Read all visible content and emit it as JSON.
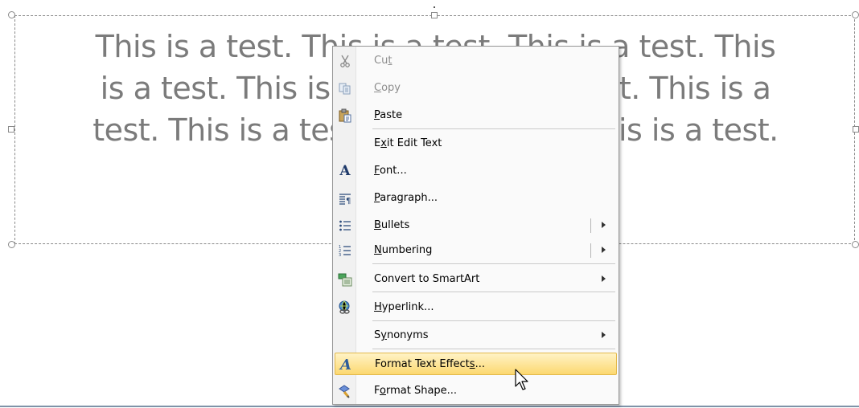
{
  "slide": {
    "text_lines": [
      "This is a test. This is a test. This is a test. This",
      "is a test. This is a test. This is a test. This is a",
      "test. This is a test. This is a test. This is a test."
    ],
    "text_color": "#7b7b7b"
  },
  "context_menu": {
    "items": [
      {
        "label": "Cut",
        "mnemonic": "t",
        "icon": "scissors-icon",
        "disabled": true
      },
      {
        "label": "Copy",
        "mnemonic": "C",
        "icon": "copy-icon",
        "disabled": true
      },
      {
        "label": "Paste",
        "mnemonic": "P",
        "icon": "paste-icon",
        "disabled": false
      },
      {
        "label": "Exit Edit Text",
        "mnemonic": "x",
        "icon": "",
        "disabled": false
      },
      {
        "label": "Font...",
        "mnemonic": "F",
        "icon": "font-icon",
        "disabled": false
      },
      {
        "label": "Paragraph...",
        "mnemonic": "P",
        "icon": "paragraph-icon",
        "disabled": false
      },
      {
        "label": "Bullets",
        "mnemonic": "B",
        "icon": "bullets-icon",
        "disabled": false,
        "submenu": true
      },
      {
        "label": "Numbering",
        "mnemonic": "N",
        "icon": "numbering-icon",
        "disabled": false,
        "submenu": true
      },
      {
        "label": "Convert to SmartArt",
        "mnemonic": "M",
        "icon": "smartart-icon",
        "disabled": false,
        "submenu": true
      },
      {
        "label": "Hyperlink...",
        "mnemonic": "H",
        "icon": "hyperlink-icon",
        "disabled": false
      },
      {
        "label": "Synonyms",
        "mnemonic": "y",
        "icon": "",
        "disabled": false,
        "submenu": true
      },
      {
        "label": "Format Text Effects...",
        "mnemonic": "s",
        "icon": "format-text-effects-icon",
        "disabled": false,
        "highlighted": true
      },
      {
        "label": "Format Shape...",
        "mnemonic": "o",
        "icon": "format-shape-icon",
        "disabled": false
      }
    ],
    "highlight_color": "#fcd870"
  }
}
